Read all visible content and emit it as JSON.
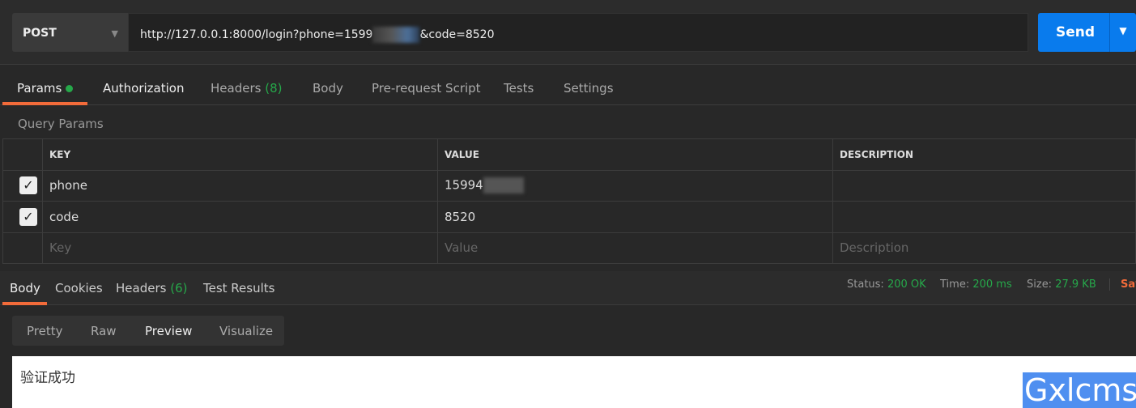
{
  "request": {
    "method": "POST",
    "url_prefix": "http://127.0.0.1:8000/login?phone=1599",
    "url_suffix": "&code=8520",
    "send_label": "Send"
  },
  "tabs": [
    {
      "label": "Params"
    },
    {
      "label": "Authorization"
    },
    {
      "label": "Headers",
      "count": "(8)"
    },
    {
      "label": "Body"
    },
    {
      "label": "Pre-request Script"
    },
    {
      "label": "Tests"
    },
    {
      "label": "Settings"
    }
  ],
  "query_params": {
    "title": "Query Params",
    "headers": [
      "KEY",
      "VALUE",
      "DESCRIPTION"
    ],
    "rows": [
      {
        "key": "phone",
        "value": "15994",
        "checked": true
      },
      {
        "key": "code",
        "value": "8520",
        "checked": true
      }
    ],
    "placeholders": {
      "key": "Key",
      "value": "Value",
      "description": "Description"
    }
  },
  "response": {
    "tabs": [
      {
        "label": "Body"
      },
      {
        "label": "Cookies"
      },
      {
        "label": "Headers",
        "count": "(6)"
      },
      {
        "label": "Test Results"
      }
    ],
    "status_label": "Status:",
    "status": "200 OK",
    "time_label": "Time:",
    "time": "200 ms",
    "size_label": "Size:",
    "size": "27.9 KB",
    "save": "Sav",
    "formats": [
      "Pretty",
      "Raw",
      "Preview",
      "Visualize"
    ],
    "body": "验证成功"
  },
  "watermark": "Gxlcms",
  "colors": {
    "accent": "#f26b3a",
    "send": "#097bed",
    "success": "#26a84a"
  }
}
